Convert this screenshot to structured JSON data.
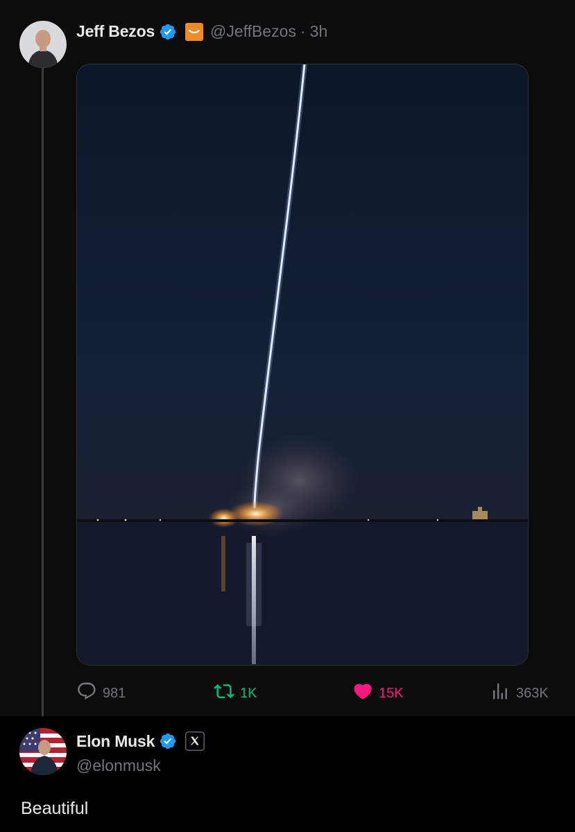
{
  "quoted_post": {
    "author_name": "Jeff Bezos",
    "author_handle": "@JeffBezos",
    "separator": "·",
    "time": "3h",
    "affiliation_icon": "amazon-smile-icon",
    "media_description_icon": "rocket-launch-photo",
    "actions": {
      "replies": "981",
      "reposts": "1K",
      "likes": "15K",
      "views": "363K"
    }
  },
  "reply_post": {
    "author_name": "Elon Musk",
    "author_handle": "@elonmusk",
    "affiliation_icon": "x-logo-icon",
    "text": "Beautiful"
  },
  "colors": {
    "verified": "#1d9bf0",
    "repost": "#00ba7c",
    "like": "#f91880",
    "muted": "#71767b",
    "amazon_badge": "#ff9900"
  }
}
